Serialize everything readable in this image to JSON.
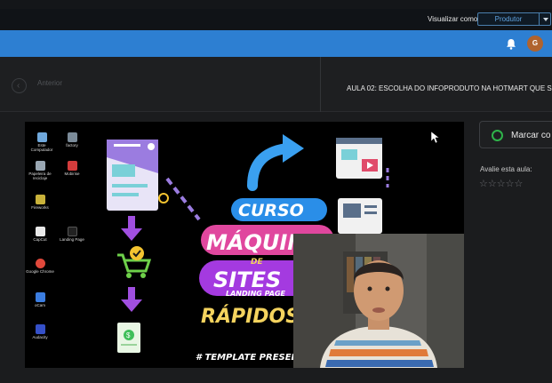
{
  "topbar": {
    "view_as_label": "Visualizar como",
    "view_as_value": "Produtor"
  },
  "header": {
    "avatar_initial": "G",
    "accent_color": "#2d7fd2"
  },
  "lesson_nav": {
    "previous_label": "Anterior",
    "lesson_title": "AULA 02: ESCOLHA DO INFOPRODUTO NA HOTMART QUE S"
  },
  "video": {
    "desktop_icons": [
      {
        "label": "Este Computador",
        "color": "#6fa8dc"
      },
      {
        "label": "Papeleira de reciclaje",
        "color": "#9aa7b3"
      },
      {
        "label": "Fireworks",
        "color": "#c9b23a"
      },
      {
        "label": "CapCut",
        "color": "#e8e8e8"
      },
      {
        "label": "Google Chrome",
        "color": "#e0483b"
      },
      {
        "label": "oCam",
        "color": "#3b7de0"
      },
      {
        "label": "Audacity",
        "color": "#3550c8"
      },
      {
        "label": "factory",
        "color": "#7b8b99"
      },
      {
        "label": "Mobirise",
        "color": "#d43c3c"
      },
      {
        "label": "Landing Page",
        "color": "#222222"
      }
    ],
    "course_lines": [
      "CURSO",
      "MÁQUINA",
      "DE",
      "SITES",
      "LANDING PAGE",
      "RÁPIDOS"
    ],
    "footer_text": "# TEMPLATE PRESELL"
  },
  "sidebar": {
    "mark_label": "Marcar co",
    "rate_label": "Avalie esta aula:",
    "rating": 0,
    "max_rating": 5
  }
}
